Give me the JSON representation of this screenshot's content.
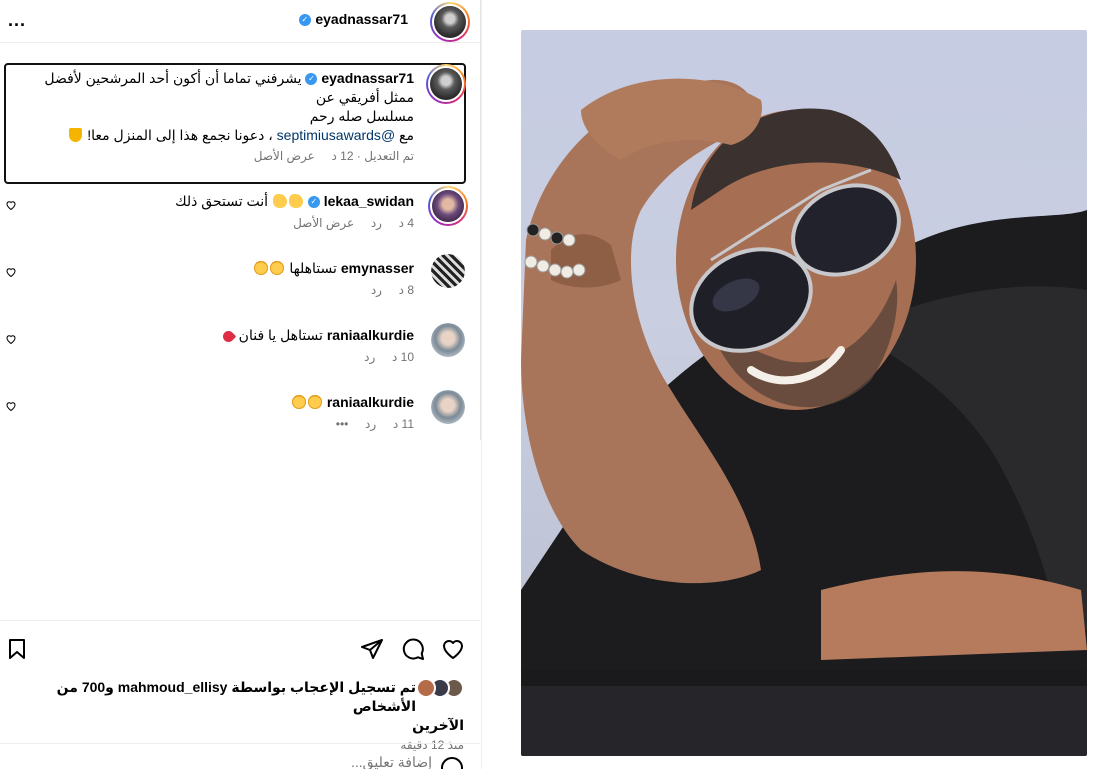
{
  "post": {
    "username": "eyadnassar71",
    "more_label": "..."
  },
  "caption": {
    "username": "eyadnassar71",
    "line1": "يشرفني تماما أن أكون أحد المرشحين لأفضل ممثل أفريقي عن",
    "line2": "مسلسل صله رحم",
    "line3_prefix": "مع ",
    "mention": "@septimiusawards",
    "line3_suffix": " ، دعونا نجمع هذا إلى المنزل معا!",
    "edited": "تم التعديل",
    "time": "12 د",
    "see_original": "عرض الأصل"
  },
  "comments": [
    {
      "username": "lekaa_swidan",
      "verified": true,
      "text": "أنت تستحق ذلك",
      "time": "4 د",
      "reply": "رد",
      "extra": "عرض الأصل",
      "avatar": "lekaa"
    },
    {
      "username": "emynasser",
      "verified": false,
      "text": "تستاهلها",
      "time": "8 د",
      "reply": "رد",
      "extra": "",
      "avatar": "emy"
    },
    {
      "username": "raniaalkurdie",
      "verified": false,
      "text": "تستاهل يا فنان",
      "time": "10 د",
      "reply": "رد",
      "extra": "",
      "avatar": "rania"
    },
    {
      "username": "raniaalkurdie",
      "verified": false,
      "text": "",
      "time": "11 د",
      "reply": "رد",
      "extra": "•••",
      "avatar": "rania"
    }
  ],
  "likes": {
    "line1": "تم تسجيل الإعجاب بواسطة mahmoud_ellisy و700 من الأشخاص",
    "line2": "الآخرين",
    "time": "منذ 12 دقيقة"
  },
  "add_comment": {
    "placeholder": "إضافة تعليق..."
  },
  "icons": {
    "like": "heart-icon",
    "comment": "comment-icon",
    "share": "share-icon",
    "save": "bookmark-icon",
    "verified": "verified-badge-icon"
  },
  "colors": {
    "verified": "#3897f0",
    "link": "#00376b",
    "meta": "#737373"
  }
}
